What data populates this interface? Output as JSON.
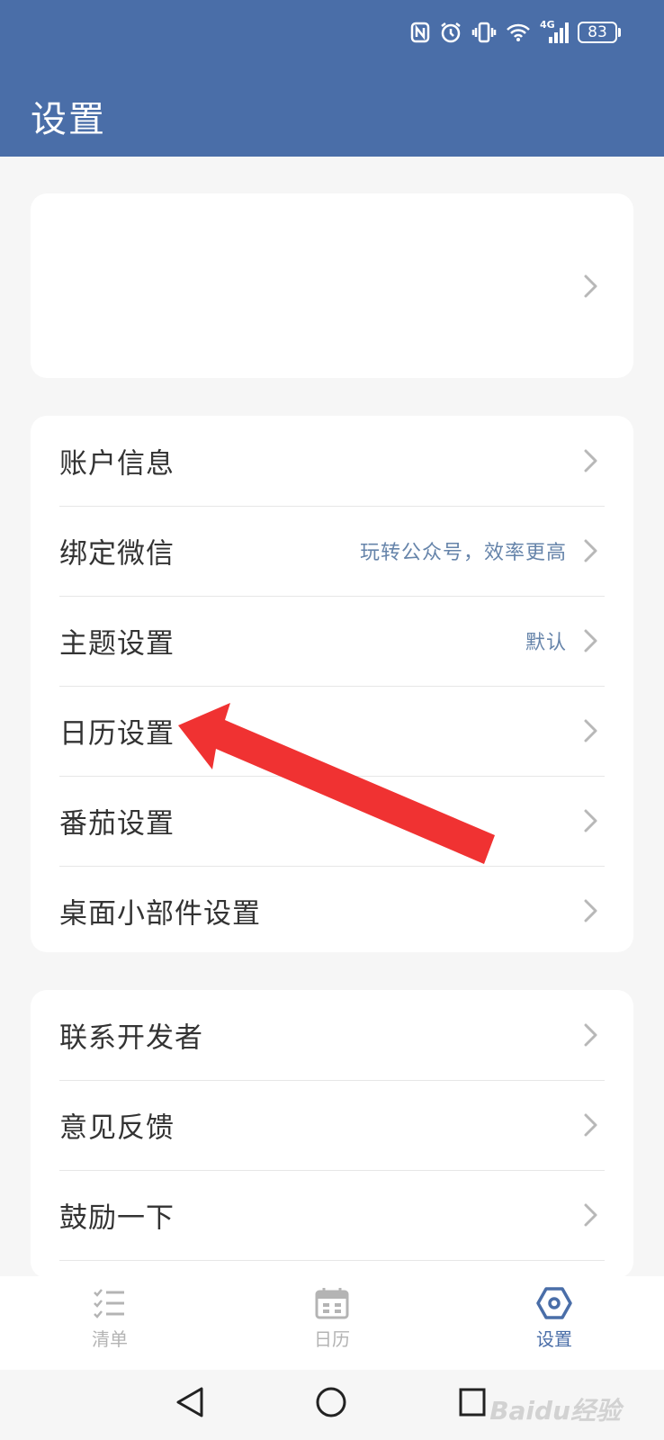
{
  "header": {
    "title": "设置",
    "battery": "83",
    "network": "4G"
  },
  "groups": [
    {
      "items": [
        {
          "label": "账户信息",
          "hint": ""
        },
        {
          "label": "绑定微信",
          "hint": "玩转公众号，效率更高"
        },
        {
          "label": "主题设置",
          "hint": "默认"
        },
        {
          "label": "日历设置",
          "hint": ""
        },
        {
          "label": "番茄设置",
          "hint": ""
        },
        {
          "label": "桌面小部件设置",
          "hint": ""
        }
      ]
    },
    {
      "items": [
        {
          "label": "联系开发者",
          "hint": ""
        },
        {
          "label": "意见反馈",
          "hint": ""
        },
        {
          "label": "鼓励一下",
          "hint": ""
        }
      ]
    }
  ],
  "tabbar": {
    "tabs": [
      {
        "label": "清单",
        "icon": "checklist-icon",
        "active": false
      },
      {
        "label": "日历",
        "icon": "calendar-icon",
        "active": false
      },
      {
        "label": "设置",
        "icon": "settings-hexagon-icon",
        "active": true
      }
    ]
  },
  "navbar": {
    "buttons": [
      "back-icon",
      "home-icon",
      "recents-icon"
    ]
  },
  "annotation": {
    "arrow_color": "#f03232",
    "points_to": "日历设置"
  },
  "watermark": "Baidu经验",
  "colors": {
    "header": "#4a6ea8",
    "accent": "#4a6ea8",
    "hint": "#6684aa",
    "background": "#f6f6f6"
  }
}
